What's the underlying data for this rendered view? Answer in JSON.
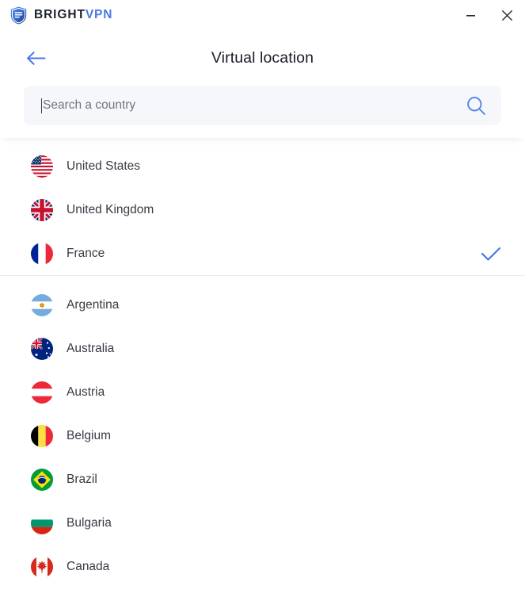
{
  "window": {
    "brand_primary": "BRIGHT",
    "brand_secondary": "VPN",
    "brand_accent_color": "#4779e8",
    "minimize_label": "Minimize",
    "close_label": "Close"
  },
  "header": {
    "back_label": "Back",
    "title": "Virtual location"
  },
  "search": {
    "value": "",
    "placeholder": "Search a country",
    "icon": "search-icon"
  },
  "list": {
    "recommended": [
      {
        "name": "United States",
        "flag": "us",
        "selected": false
      },
      {
        "name": "United Kingdom",
        "flag": "gb",
        "selected": false
      },
      {
        "name": "France",
        "flag": "fr",
        "selected": true
      }
    ],
    "all": [
      {
        "name": "Argentina",
        "flag": "ar",
        "selected": false
      },
      {
        "name": "Australia",
        "flag": "au",
        "selected": false
      },
      {
        "name": "Austria",
        "flag": "at",
        "selected": false
      },
      {
        "name": "Belgium",
        "flag": "be",
        "selected": false
      },
      {
        "name": "Brazil",
        "flag": "br",
        "selected": false
      },
      {
        "name": "Bulgaria",
        "flag": "bg",
        "selected": false
      },
      {
        "name": "Canada",
        "flag": "ca",
        "selected": false
      }
    ]
  },
  "colors": {
    "accent": "#4779e8",
    "title_text": "#1b1b2c",
    "row_text": "#3a3a45",
    "search_bg": "#f5f7fa",
    "divider": "#ececf1"
  }
}
